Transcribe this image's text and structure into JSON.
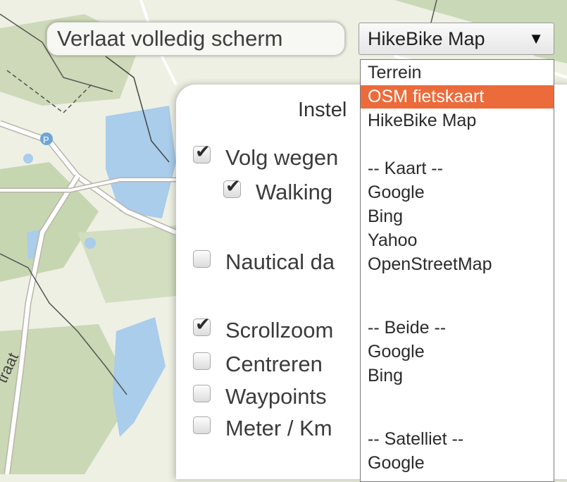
{
  "map": {
    "road_label": "traat",
    "marker_label": "P",
    "colors": {
      "background": "#eef0e4",
      "water": "#a9cdea",
      "woods": "#c8d8b4",
      "road": "#ffffff",
      "road_casing": "#b9b4aa"
    }
  },
  "fullscreen_button": {
    "label": "Verlaat volledig scherm"
  },
  "map_select": {
    "selected": "HikeBike Map",
    "arrow_icon": "triangle-down-icon"
  },
  "settings": {
    "title": "Instel",
    "options": [
      {
        "label": "Volg wegen",
        "checked": true
      },
      {
        "label": "Walking",
        "checked": true
      },
      {
        "label": "Nautical da",
        "checked": false
      },
      {
        "label": "Scrollzoom",
        "checked": true
      },
      {
        "label": "Centreren",
        "checked": false
      },
      {
        "label": "Waypoints",
        "checked": false
      },
      {
        "label": "Meter / Km",
        "checked": false
      }
    ]
  },
  "dropdown": {
    "items": [
      {
        "label": "Terrein"
      },
      {
        "label": "OSM fietskaart",
        "selected": true
      },
      {
        "label": "HikeBike Map"
      },
      {
        "label": ""
      },
      {
        "label": "-- Kaart --"
      },
      {
        "label": "Google"
      },
      {
        "label": "Bing"
      },
      {
        "label": "Yahoo"
      },
      {
        "label": "OpenStreetMap"
      },
      {
        "label": ""
      },
      {
        "label": "-- Beide --"
      },
      {
        "label": "Google"
      },
      {
        "label": "Bing"
      },
      {
        "label": ""
      },
      {
        "label": "-- Satelliet --"
      },
      {
        "label": "Google"
      }
    ],
    "selected_color": "#ec6b3b"
  }
}
